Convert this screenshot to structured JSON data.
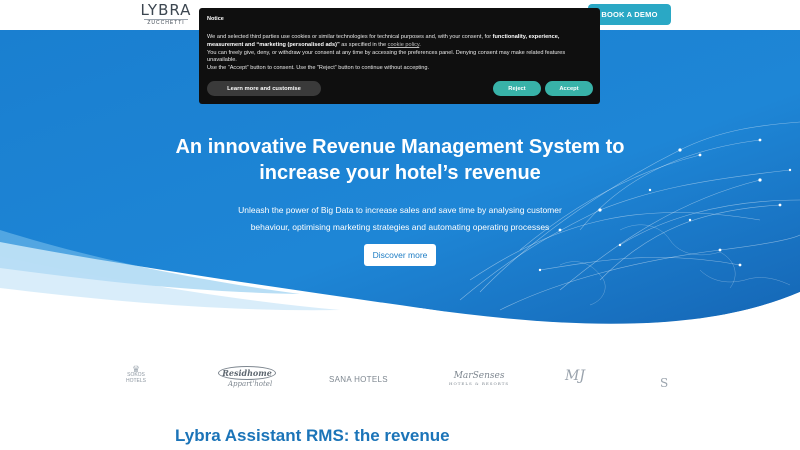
{
  "header": {
    "logo_main": "LYBRA",
    "logo_sub": "ZUCCHETTI",
    "demo_button": "BOOK A DEMO"
  },
  "hero": {
    "title": "An innovative Revenue Management System to increase your hotel’s revenue",
    "subtitle": "Unleash the power of Big Data to increase sales and save time by analysing customer behaviour, optimising marketing strategies and automating operating processes",
    "cta": "Discover more"
  },
  "brands": {
    "b1": "SOKOS",
    "b1_sub": "HOTELS",
    "b2_top": "Residhome",
    "b2_script": "Appart'hotel",
    "b3": "SANA HOTELS",
    "b4": "MarSenses",
    "b4_sub": "HOTELS & RESORTS",
    "b5": "MJ",
    "b6": "S"
  },
  "section": {
    "title": "Lybra Assistant RMS: the revenue"
  },
  "cookie": {
    "title": "Notice",
    "text_1": "We and selected third parties use cookies or similar technologies for technical purposes and, with your consent, for ",
    "text_bold": "functionality, experience, measurement and “marketing (personalised ads)”",
    "text_2": " as specified in the ",
    "policy_link": "cookie policy",
    "text_3": "You can freely give, deny, or withdraw your consent at any time by accessing the preferences panel. Denying consent may make related features unavailable.",
    "text_4": "Use the “Accept” button to consent. Use the “Reject” button to continue without accepting.",
    "learn_button": "Learn more and customise",
    "reject_button": "Reject",
    "accept_button": "Accept"
  },
  "colors": {
    "hero_blue": "#1e86d6",
    "hero_blue_dark": "#1768b8",
    "button_teal": "#38b2a8",
    "demo_teal": "#2aa8c5",
    "title_blue": "#1b74b8"
  }
}
